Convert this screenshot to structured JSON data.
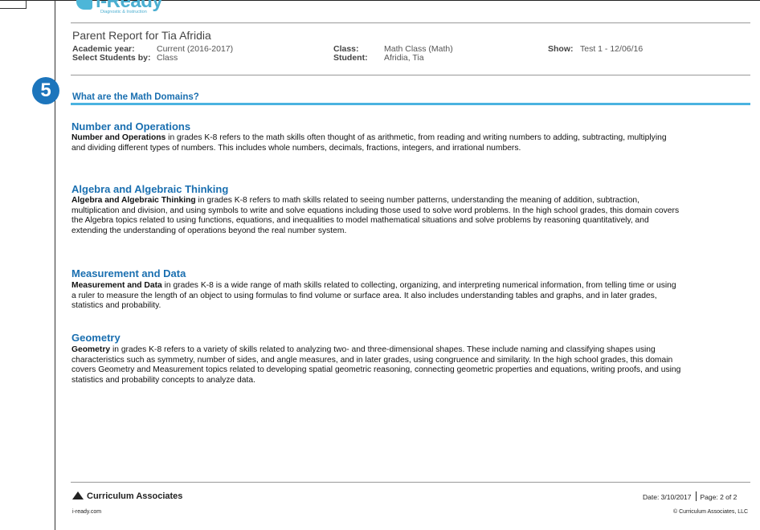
{
  "brand": {
    "logo_word": "i-Ready",
    "logo_sub": "Diagnostic & Instruction"
  },
  "report": {
    "title": "Parent Report for Tia Afridia",
    "academic_year_label": "Academic year:",
    "academic_year_value": "Current (2016-2017)",
    "select_label": "Select Students by:",
    "select_value": "Class",
    "class_label": "Class:",
    "class_value": "Math Class (Math)",
    "student_label": "Student:",
    "student_value": "Afridia, Tia",
    "show_label": "Show:",
    "show_value": "Test 1 - 12/06/16"
  },
  "badge": "5",
  "section_heading": "What are the Math Domains?",
  "domains": [
    {
      "title": "Number and Operations",
      "lead": "Number and Operations",
      "body": " in grades K-8 refers to the math skills often thought of as arithmetic, from reading and writing numbers to adding, subtracting, multiplying and dividing different types of numbers. This includes whole numbers, decimals, fractions, integers, and irrational numbers."
    },
    {
      "title": "Algebra and Algebraic Thinking",
      "lead": "Algebra and Algebraic Thinking",
      "body": " in grades K-8 refers to math skills related to seeing number patterns, understanding the meaning of addition, subtraction, multiplication and division, and using symbols to write and solve equations including those used to solve word problems. In the high school grades, this domain covers the Algebra topics related to using functions, equations, and inequalities to model mathematical situations and solve problems by reasoning quantitatively, and extending the understanding of operations beyond the real number system."
    },
    {
      "title": "Measurement and Data",
      "lead": "Measurement and Data",
      "body": " in grades K-8 is a wide range of math skills related to collecting, organizing, and interpreting numerical information, from telling time or using a ruler to measure the length of an object to using formulas to find volume or surface area. It also includes understanding tables and graphs, and in later grades, statistics and probability."
    },
    {
      "title": "Geometry",
      "lead": "Geometry",
      "body": " in grades K-8 refers to a variety of skills related to analyzing two- and three-dimensional shapes. These include naming and classifying shapes using characteristics such as symmetry, number of sides, and angle measures, and in later grades, using congruence and similarity. In the high school grades, this domain covers Geometry and Measurement topics related to developing spatial geometric reasoning, connecting geometric properties and equations, writing proofs, and using statistics and probability concepts to analyze data."
    }
  ],
  "footer": {
    "company": "Curriculum Associates",
    "website": "i-ready.com",
    "date": "Date: 3/10/2017",
    "page": "Page: 2 of 2",
    "copyright": "© Curriculum Associates, LLC"
  }
}
